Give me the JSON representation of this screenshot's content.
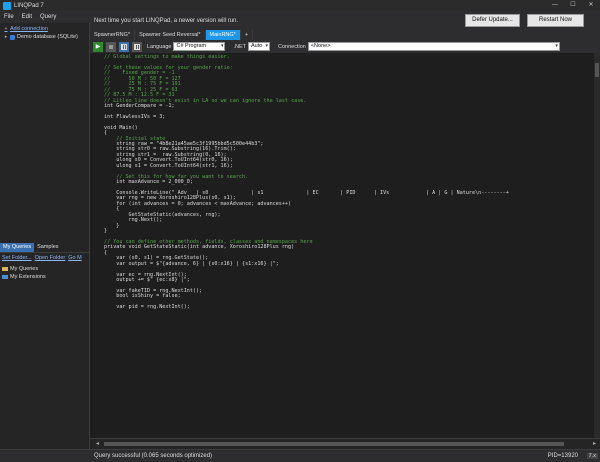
{
  "window": {
    "title": "LINQPad 7",
    "min": "—",
    "max": "☐",
    "close": "✕"
  },
  "menu": {
    "file": "File",
    "edit": "Edit",
    "query": "Query"
  },
  "notice": {
    "message": "Next time you start LINQPad, a newer version will run.",
    "defer": "Defer Update...",
    "restart": "Restart Now"
  },
  "connections": {
    "add": "Add connection",
    "demo": "Demo database (SQLite)"
  },
  "query_tabs": {
    "my_queries": "My Queries",
    "samples": "Samples"
  },
  "query_links": {
    "set_folder": "Set Folder...",
    "open_folder": "Open Folder",
    "go": "Go M"
  },
  "query_tree": {
    "my_queries": "My Queries",
    "my_extensions": "My Extensions"
  },
  "doc_tabs": [
    {
      "label": "SpawnerRNG*"
    },
    {
      "label": "Spawner Seed Reversal*"
    },
    {
      "label": "MainRNG*"
    },
    {
      "label": "+"
    }
  ],
  "toolbar": {
    "language_label": "Language",
    "language": "C# Program",
    "net_label": ".NET",
    "net": "Auto",
    "connection_label": "Connection",
    "connection": "<None>"
  },
  "code_lines": [
    {
      "t": "// Global settings to make things easier.",
      "c": "cm"
    },
    {
      "t": "",
      "c": ""
    },
    {
      "t": "// Set these values for your gender ratio:",
      "c": "cm"
    },
    {
      "t": "//    Fixed gender = -1",
      "c": "cm"
    },
    {
      "t": "//      50 M : 50 F = 127",
      "c": "cm"
    },
    {
      "t": "//      25 M : 75 F = 191",
      "c": "cm"
    },
    {
      "t": "//      75 M : 25 F = 63",
      "c": "cm"
    },
    {
      "t": "// 87.5 M : 12.5 F = 31",
      "c": "cm"
    },
    {
      "t": "// Litleo line doesn't exist in LA so we can ignore the last case.",
      "c": "cm"
    },
    {
      "t": "int GenderCompare = -1;",
      "c": ""
    },
    {
      "t": "",
      "c": ""
    },
    {
      "t": "int FlawlessIVs = 3;",
      "c": ""
    },
    {
      "t": "",
      "c": ""
    },
    {
      "t": "void Main()",
      "c": ""
    },
    {
      "t": "{",
      "c": ""
    },
    {
      "t": "    // Initial state",
      "c": "cm"
    },
    {
      "t": "    string raw = \"4b8e21a45ae5c3f1995bbd5c500e44b3\";",
      "c": ""
    },
    {
      "t": "    string str0 = raw.Substring(16).Trim();",
      "c": ""
    },
    {
      "t": "    string str1 =  raw.Substring(0, 16);",
      "c": ""
    },
    {
      "t": "    ulong s0 = Convert.ToUInt64(str0, 16);",
      "c": ""
    },
    {
      "t": "    ulong s1 = Convert.ToUInt64(str1, 16);",
      "c": ""
    },
    {
      "t": "",
      "c": ""
    },
    {
      "t": "    // Set this for how far you want to search.",
      "c": "cm"
    },
    {
      "t": "    int maxAdvance = 2_000_0;",
      "c": ""
    },
    {
      "t": "",
      "c": ""
    },
    {
      "t": "    Console.WriteLine(\" Adv   | s0              | s1              | EC       | PID      | IVs            | A | G | Nature\\n--------+",
      "c": ""
    },
    {
      "t": "    var rng = new Xoroshiro128Plus(s0, s1);",
      "c": ""
    },
    {
      "t": "    for (int advances = 0; advances < maxAdvance; advances++)",
      "c": ""
    },
    {
      "t": "    {",
      "c": ""
    },
    {
      "t": "        GetStateStatic(advances, rng);",
      "c": ""
    },
    {
      "t": "        rng.Next();",
      "c": ""
    },
    {
      "t": "    }",
      "c": ""
    },
    {
      "t": "}",
      "c": ""
    },
    {
      "t": "",
      "c": ""
    },
    {
      "t": "// You can define other methods, fields, classes and namespaces here",
      "c": "cm"
    },
    {
      "t": "private void GetStateStatic(int advance, Xoroshiro128Plus rng)",
      "c": ""
    },
    {
      "t": "{",
      "c": ""
    },
    {
      "t": "    var (s0, s1) = rng.GetState();",
      "c": ""
    },
    {
      "t": "    var output = $\"{advance, 6} | {s0:x16} | {s1:x16} |\";",
      "c": ""
    },
    {
      "t": "",
      "c": ""
    },
    {
      "t": "    var ec = rng.NextInt();",
      "c": ""
    },
    {
      "t": "    output += $\" {ec:x8} |\";",
      "c": ""
    },
    {
      "t": "",
      "c": ""
    },
    {
      "t": "    var fakeTID = rng.NextInt();",
      "c": ""
    },
    {
      "t": "    bool isShiny = false;",
      "c": ""
    },
    {
      "t": "",
      "c": ""
    },
    {
      "t": "    var pid = rng.NextInt();",
      "c": ""
    }
  ],
  "status": {
    "text": "Query successful  (0.065 seconds optimized)",
    "pid": "PID=13920",
    "version": "7.x"
  }
}
